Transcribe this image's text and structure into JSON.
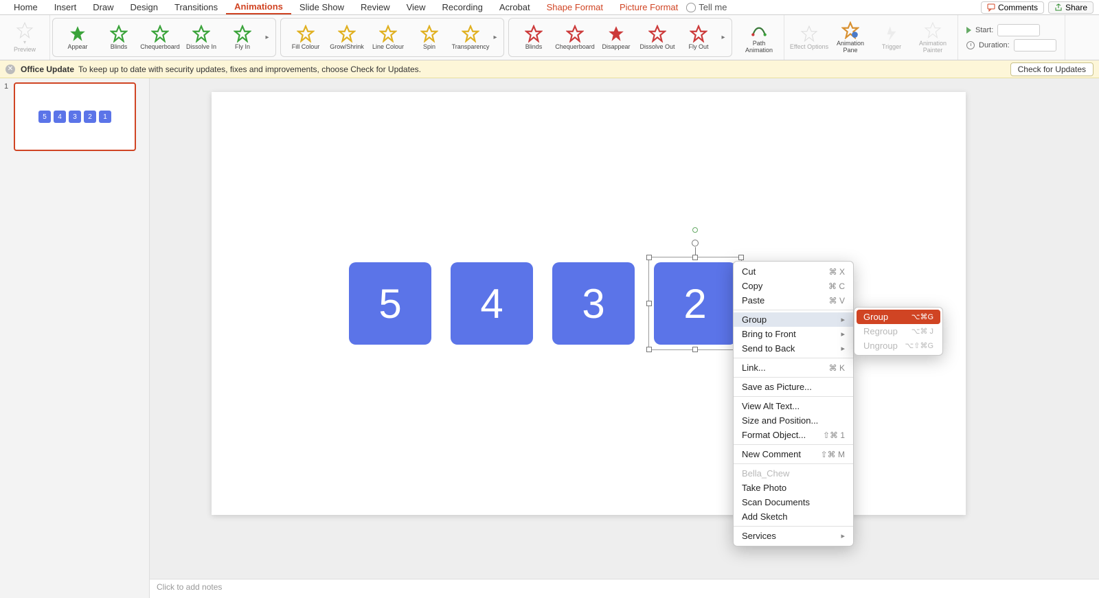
{
  "tabs": {
    "home": "Home",
    "insert": "Insert",
    "draw": "Draw",
    "design": "Design",
    "transitions": "Transitions",
    "animations": "Animations",
    "slideshow": "Slide Show",
    "review": "Review",
    "view": "View",
    "recording": "Recording",
    "acrobat": "Acrobat",
    "shapefmt": "Shape Format",
    "picfmt": "Picture Format",
    "tellme": "Tell me"
  },
  "topbuttons": {
    "comments": "Comments",
    "share": "Share"
  },
  "ribbon": {
    "preview": "Preview",
    "entrance": [
      "Appear",
      "Blinds",
      "Chequerboard",
      "Dissolve In",
      "Fly In"
    ],
    "emphasis": [
      "Fill Colour",
      "Grow/Shrink",
      "Line Colour",
      "Spin",
      "Transparency"
    ],
    "exit": [
      "Blinds",
      "Chequerboard",
      "Disappear",
      "Dissolve Out",
      "Fly Out"
    ],
    "path": "Path Animation",
    "effect": "Effect Options",
    "pane": "Animation Pane",
    "trigger": "Trigger",
    "painter": "Animation Painter",
    "start": "Start:",
    "duration": "Duration:"
  },
  "notice": {
    "title": "Office Update",
    "text": "To keep up to date with security updates, fixes and improvements, choose Check for Updates.",
    "button": "Check for Updates"
  },
  "thumb": {
    "num": "1",
    "boxes": [
      "5",
      "4",
      "3",
      "2",
      "1"
    ]
  },
  "slide": {
    "b5": "5",
    "b4": "4",
    "b3": "3",
    "b2": "2",
    "b1": ""
  },
  "notes": "Click to add notes",
  "ctx": {
    "cut": "Cut",
    "cut_sc": "⌘ X",
    "copy": "Copy",
    "copy_sc": "⌘ C",
    "paste": "Paste",
    "paste_sc": "⌘ V",
    "group": "Group",
    "front": "Bring to Front",
    "back": "Send to Back",
    "link": "Link...",
    "link_sc": "⌘ K",
    "savepic": "Save as Picture...",
    "alttext": "View Alt Text...",
    "sizepos": "Size and Position...",
    "fmtobj": "Format Object...",
    "fmtobj_sc": "⇧⌘ 1",
    "newcom": "New Comment",
    "newcom_sc": "⇧⌘ M",
    "bella": "Bella_Chew",
    "photo": "Take Photo",
    "scan": "Scan Documents",
    "sketch": "Add Sketch",
    "services": "Services"
  },
  "submenu": {
    "group": "Group",
    "group_sc": "⌥⌘G",
    "regroup": "Regroup",
    "regroup_sc": "⌥⌘ J",
    "ungroup": "Ungroup",
    "ungroup_sc": "⌥⇧⌘G"
  }
}
